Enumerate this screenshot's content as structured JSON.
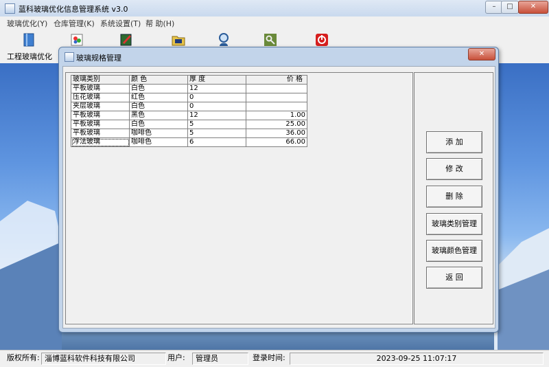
{
  "window": {
    "title": "蓝科玻璃优化信息管理系统 v3.0",
    "controls": [
      "–",
      "□",
      "✕"
    ]
  },
  "menu": [
    "玻璃优化(Y)",
    "仓库管理(K)",
    "系统设置(T)",
    "帮 助(H)"
  ],
  "toolbar": {
    "first_label": "工程玻璃优化",
    "icons": [
      "book-icon",
      "paint-icon",
      "edit-icon",
      "folder-icon",
      "search-user-icon",
      "key-icon",
      "power-icon"
    ]
  },
  "dialog": {
    "title": "玻璃规格管理",
    "close": "✕",
    "columns": [
      "玻璃类别",
      "颜 色",
      "厚 度",
      "价 格"
    ],
    "rows": [
      [
        "平板玻璃",
        "白色",
        "12",
        ""
      ],
      [
        "压花玻璃",
        "红色",
        "0",
        ""
      ],
      [
        "夹层玻璃",
        "白色",
        "0",
        ""
      ],
      [
        "平板玻璃",
        "黑色",
        "12",
        "1.00"
      ],
      [
        "平板玻璃",
        "白色",
        "5",
        "25.00"
      ],
      [
        "平板玻璃",
        "咖啡色",
        "5",
        "36.00"
      ],
      [
        "浮法玻璃",
        "咖啡色",
        "6",
        "66.00"
      ]
    ],
    "buttons": {
      "add": "添 加",
      "edit": "修 改",
      "delete": "删 除",
      "category": "玻璃类别管理",
      "color": "玻璃颜色管理",
      "back": "返 回"
    }
  },
  "status": {
    "copyright_label": "版权所有:",
    "copyright_value": "淄博蓝科软件科技有限公司",
    "user_label": "用户:",
    "user_value": "管理员",
    "login_label": "登录时间:",
    "login_value": "2023-09-25 11:07:17"
  }
}
